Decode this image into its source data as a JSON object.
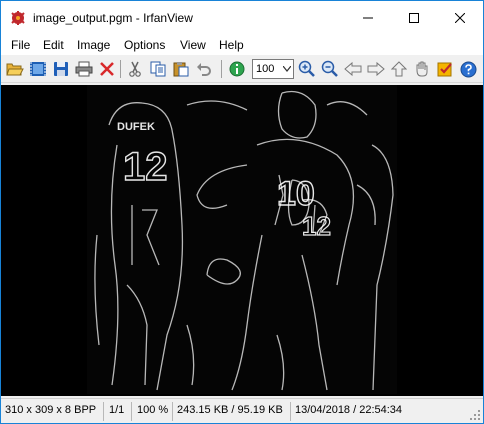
{
  "window": {
    "title": "image_output.pgm - IrfanView",
    "controls": [
      "minimize",
      "maximize",
      "close"
    ]
  },
  "menu": {
    "items": [
      "File",
      "Edit",
      "Image",
      "Options",
      "View",
      "Help"
    ]
  },
  "toolbar": {
    "icons": [
      "open-folder-icon",
      "thumbnails-icon",
      "save-icon",
      "print-icon",
      "delete-icon",
      "cut-icon",
      "copy-icon",
      "paste-icon",
      "undo-icon",
      "info-icon",
      "zoom-in-icon",
      "zoom-out-icon",
      "previous-icon",
      "next-icon",
      "first-icon",
      "last-icon",
      "hand-icon",
      "settings-icon",
      "help-icon"
    ],
    "zoom_value": "100"
  },
  "viewer": {
    "image_description": "edge-detected grayscale photo of football players",
    "jersey_numbers": [
      "12",
      "10",
      "12"
    ],
    "jersey_name": "DUFEK"
  },
  "status": {
    "dimensions": "310 x 309 x 8 BPP",
    "page": "1/1",
    "zoom": "100 %",
    "size": "243.15 KB / 95.19 KB",
    "datetime": "13/04/2018 / 22:54:34"
  },
  "colors": {
    "title_bg": "#ffffff",
    "border": "#1883d7",
    "viewer_bg": "#000000",
    "chrome_bg": "#f0f0f0"
  }
}
